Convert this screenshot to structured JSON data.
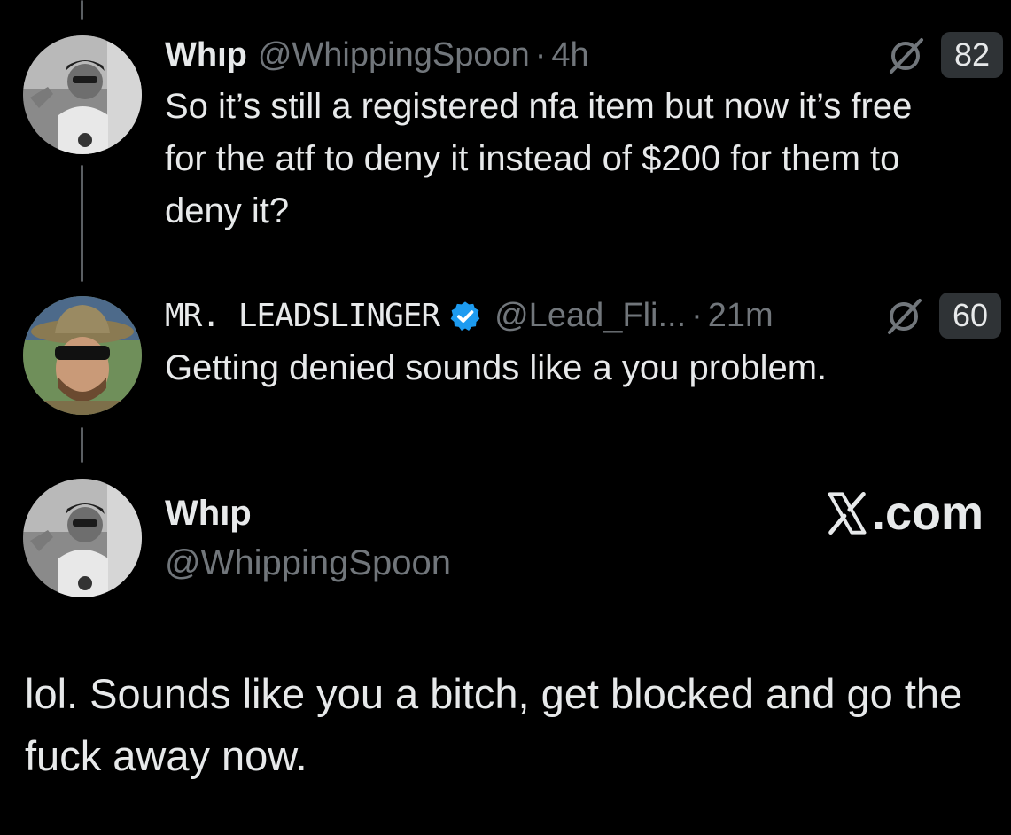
{
  "tweets": [
    {
      "display_name": "Whıp",
      "handle": "@WhippingSpoon",
      "separator": "·",
      "time": "4h",
      "text": "So it’s still a registered nfa item but now it’s free for the atf to deny it instead of $200 for them to deny it?",
      "count": "82"
    },
    {
      "display_name": "MR. LEADSLINGER",
      "handle": "@Lead_Fli...",
      "separator": "·",
      "time": "21m",
      "text": "Getting denied sounds like a you problem.",
      "count": "60"
    }
  ],
  "quote": {
    "display_name": "Whıp",
    "handle": "@WhippingSpoon",
    "brand": ".com",
    "text": "lol. Sounds like you a bitch, get blocked and go the fuck away now."
  },
  "colors": {
    "background": "#000000",
    "text": "#e7e9ea",
    "muted": "#71767b",
    "verified": "#1d9bf0",
    "badge": "#2f3336"
  },
  "icons": {
    "grok": "grok-icon",
    "verified": "verified-badge-icon",
    "brand": "x-logo-icon"
  }
}
